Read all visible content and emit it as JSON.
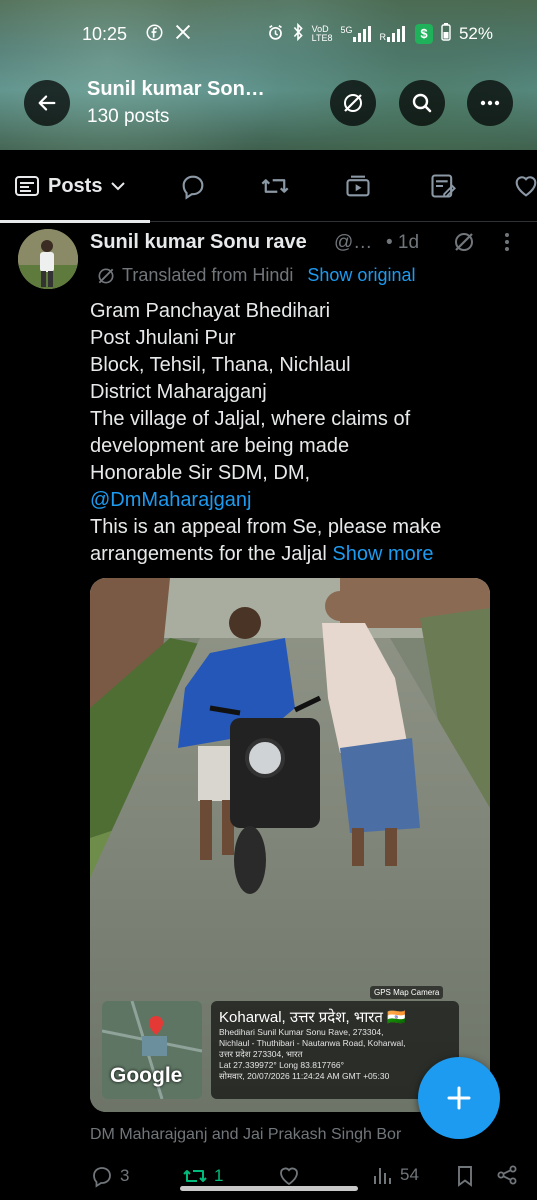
{
  "status_bar": {
    "time": "10:25",
    "left_icons": [
      "facebook-icon",
      "x-icon"
    ],
    "right_icons": [
      "alarm-icon",
      "bluetooth-icon",
      "volte-icon",
      "5g-signal-icon",
      "signal-icon",
      "dollar-app-icon",
      "battery-icon"
    ],
    "network_top": "VoD",
    "network_bottom": "LTE8",
    "signal_label": "5G",
    "signal2_label": "R",
    "battery": "52%"
  },
  "header": {
    "title": "Sunil kumar Son…",
    "subtitle": "130 posts"
  },
  "tabs": {
    "active_label": "Posts",
    "icons": [
      "replies-icon",
      "repost-icon",
      "media-icon",
      "articles-icon",
      "likes-icon"
    ]
  },
  "post": {
    "author_name": "Sunil kumar Sonu rave",
    "handle": "@…",
    "time": "• 1d",
    "translated_label": "Translated from Hindi",
    "show_original": "Show original",
    "text_lines": [
      "Gram Panchayat Bhedihari",
      "Post Jhulani Pur",
      "Block, Tehsil, Thana, Nichlaul",
      "District Maharajganj",
      "The village of Jaljal, where claims of",
      "development are being made",
      "Honorable Sir SDM, DM,"
    ],
    "mention": "@DmMaharajganj",
    "text_line_after": "This is an appeal from Se, please make",
    "text_last_line": "arrangements for the Jaljal",
    "show_more": "Show more",
    "media": {
      "gps_brand": "GPS Map Camera",
      "gps_title": "Koharwal, उत्तर प्रदेश, भारत 🇮🇳",
      "gps_line1": "Bhedihari Sunil Kumar Sonu Rave, 273304,",
      "gps_line2": "Nichlaul - Thuthibari - Nautanwa Road, Koharwal,",
      "gps_line3": "उत्तर प्रदेश 273304, भारत",
      "gps_line4": "Lat 27.339972° Long 83.817766°",
      "gps_line5": "सोमवार, 20/07/2026 11:24:24 AM GMT +05:30",
      "map_label": "Google"
    },
    "caption": "DM Maharajganj and Jai Prakash Singh Bor",
    "actions": {
      "replies": "3",
      "reposts": "1",
      "likes": "",
      "views": "54"
    }
  },
  "colors": {
    "accent": "#1d9bf0",
    "repost_green": "#00ba7c",
    "muted": "#71767b"
  }
}
